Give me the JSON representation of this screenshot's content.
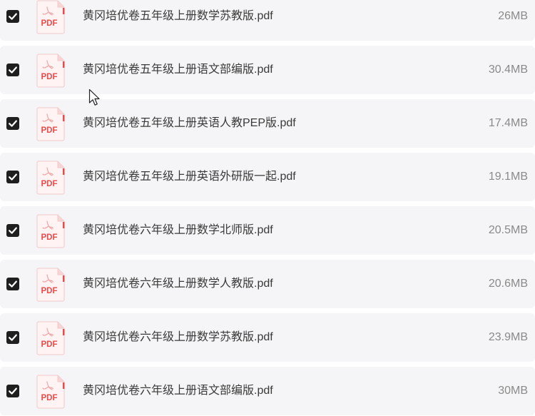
{
  "files": [
    {
      "name": "黄冈培优卷五年级上册数学苏教版.pdf",
      "size": "26MB",
      "checked": true,
      "icon": "pdf-file-icon",
      "icon_label": "PDF"
    },
    {
      "name": "黄冈培优卷五年级上册语文部编版.pdf",
      "size": "30.4MB",
      "checked": true,
      "icon": "pdf-file-icon",
      "icon_label": "PDF"
    },
    {
      "name": "黄冈培优卷五年级上册英语人教PEP版.pdf",
      "size": "17.4MB",
      "checked": true,
      "icon": "pdf-file-icon",
      "icon_label": "PDF"
    },
    {
      "name": "黄冈培优卷五年级上册英语外研版一起.pdf",
      "size": "19.1MB",
      "checked": true,
      "icon": "pdf-file-icon",
      "icon_label": "PDF"
    },
    {
      "name": "黄冈培优卷六年级上册数学北师版.pdf",
      "size": "20.5MB",
      "checked": true,
      "icon": "pdf-file-icon",
      "icon_label": "PDF"
    },
    {
      "name": "黄冈培优卷六年级上册数学人教版.pdf",
      "size": "20.6MB",
      "checked": true,
      "icon": "pdf-file-icon",
      "icon_label": "PDF"
    },
    {
      "name": "黄冈培优卷六年级上册数学苏教版.pdf",
      "size": "23.9MB",
      "checked": true,
      "icon": "pdf-file-icon",
      "icon_label": "PDF"
    },
    {
      "name": "黄冈培优卷六年级上册语文部编版.pdf",
      "size": "30MB",
      "checked": true,
      "icon": "pdf-file-icon",
      "icon_label": "PDF"
    }
  ],
  "colors": {
    "row_background": "#f5f5f7",
    "checkbox": "#1f1f1f",
    "pdf_red": "#e94b4b"
  }
}
